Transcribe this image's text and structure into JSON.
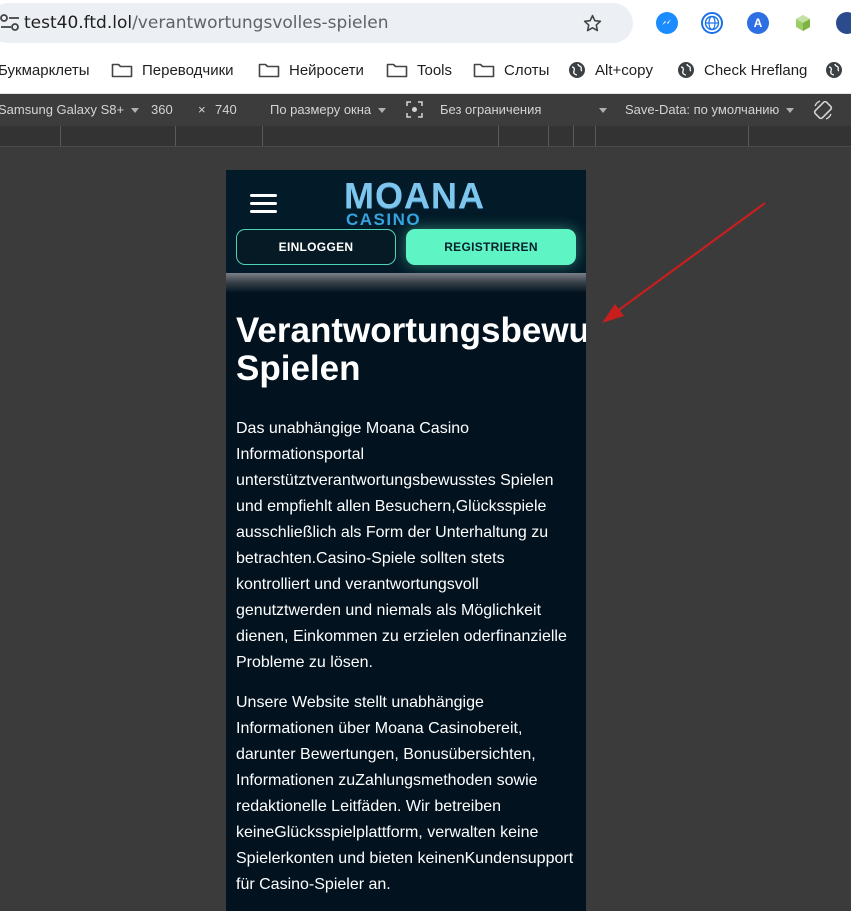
{
  "browser": {
    "url_host": "test40.ftd.lol",
    "url_path": "/verantwortungsvolles-spielen",
    "bookmarks": [
      {
        "label": "Букмарклеты",
        "icon": "none"
      },
      {
        "label": "Переводчики",
        "icon": "folder-icon"
      },
      {
        "label": "Нейросети",
        "icon": "folder-icon"
      },
      {
        "label": "Tools",
        "icon": "folder-icon"
      },
      {
        "label": "Слоты",
        "icon": "folder-icon"
      },
      {
        "label": "Alt+copy",
        "icon": "globe-icon"
      },
      {
        "label": "Check Hreflang",
        "icon": "globe-icon"
      }
    ]
  },
  "devtools": {
    "device": "Samsung Galaxy S8+",
    "width": "360",
    "times": "×",
    "height": "740",
    "zoom": "По размеру окна",
    "throttle": "Без ограничения",
    "save_data": "Save-Data: по умолчанию"
  },
  "site": {
    "logo_main": "MOANA",
    "logo_sub": "CASINO",
    "login_label": "EINLOGGEN",
    "register_label": "REGISTRIEREN",
    "heading": "Verantwortungsbewusstes Spielen",
    "heading_line1": "Verantwortungsbewusstes",
    "heading_line2": "Spielen",
    "paragraphs": [
      "Das unabhängige Moana Casino Informationsportal unterstütztverantwortungsbewusstes Spielen und empfiehlt allen Besuchern,Glücksspiele ausschließlich als Form der Unterhaltung zu betrachten.Casino-Spiele sollten stets kontrolliert und verantwortungsvoll genutztwerden und niemals als Möglichkeit dienen, Einkommen zu erzielen oderfinanzielle Probleme zu lösen.",
      "Unsere Website stellt unabhängige Informationen über Moana Casinobereit, darunter Bewertungen, Bonusübersichten, Informationen zuZahlungsmethoden sowie redaktionelle Leitfäden. Wir betreiben keineGlücksspielplattform, verwalten keine Spielerkonten und bieten keinenKundensupport für Casino-Spieler an."
    ]
  },
  "colors": {
    "page_bg": "#02121f",
    "accent": "#5ff4c4",
    "annotation_arrow": "#c81e1e"
  }
}
